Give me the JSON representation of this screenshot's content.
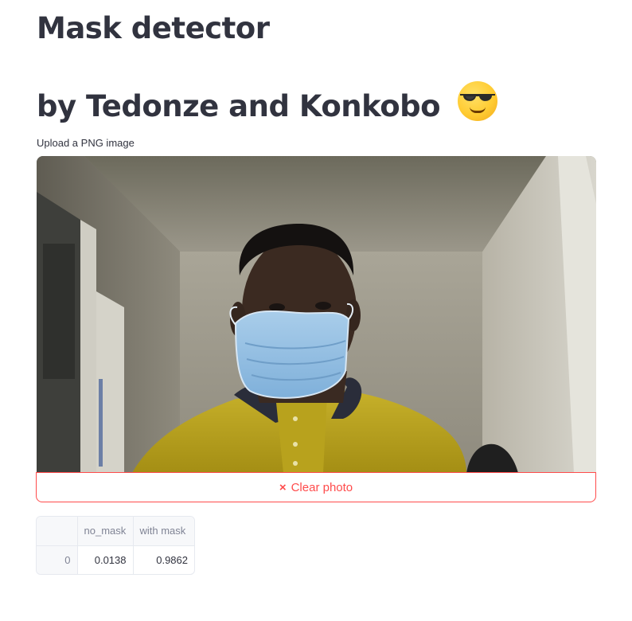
{
  "header": {
    "title": "Mask detector",
    "subtitle": "by Tedonze and Konkobo",
    "subtitle_emoji": "smiling-face-with-sunglasses-icon"
  },
  "uploader": {
    "label": "Upload a PNG image",
    "clear_button_label": "Clear photo",
    "clear_icon": "×",
    "clear_icon_name": "close-icon"
  },
  "results_table": {
    "columns": [
      "",
      "no_mask",
      "with mask"
    ],
    "rows": [
      {
        "index": "0",
        "no_mask": "0.0138",
        "with_mask": "0.9862"
      }
    ]
  },
  "colors": {
    "text": "#31333f",
    "accent": "#ff4b4b",
    "muted": "#808495",
    "border": "#e6e9ef"
  }
}
